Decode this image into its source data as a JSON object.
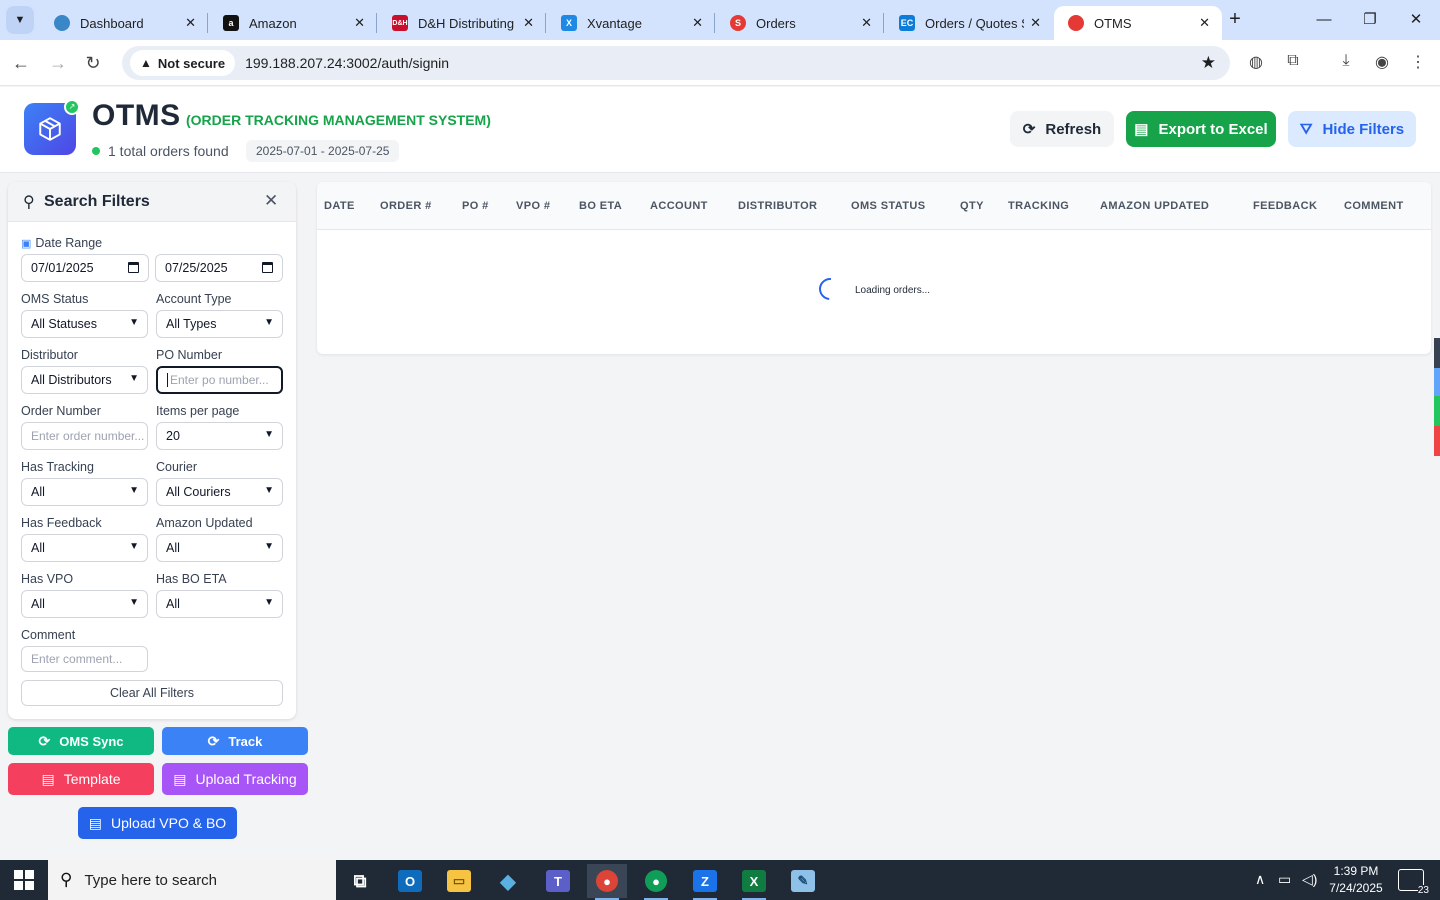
{
  "browser": {
    "tabs": [
      {
        "label": "Dashboard",
        "icon": "dashboard-favicon",
        "color": "#3a87c8"
      },
      {
        "label": "Amazon",
        "icon": "amazon-favicon",
        "color": "#111111"
      },
      {
        "label": "D&H Distributing",
        "icon": "dh-favicon",
        "color": "#c8102e"
      },
      {
        "label": "Xvantage",
        "icon": "xvantage-favicon",
        "color": "#1e88e5"
      },
      {
        "label": "Orders",
        "icon": "orders-favicon",
        "color": "#e53935"
      },
      {
        "label": "Orders / Quotes S",
        "icon": "ec-favicon",
        "color": "#0d7bd8"
      },
      {
        "label": "OTMS",
        "icon": "otms-favicon",
        "color": "#e53935"
      }
    ],
    "security_label": "Not secure",
    "url": "199.188.207.24:3002/auth/signin"
  },
  "header": {
    "title": "OTMS",
    "subtitle": "(ORDER TRACKING MANAGEMENT SYSTEM)",
    "orders_found": "1 total orders found",
    "date_range": "2025-07-01 - 2025-07-25",
    "refresh_label": "Refresh",
    "export_label": "Export to Excel",
    "hide_filters_label": "Hide Filters"
  },
  "filters": {
    "title": "Search Filters",
    "date_range_label": "Date Range",
    "date_from": "07/01/2025",
    "date_to": "07/25/2025",
    "oms_status_label": "OMS Status",
    "oms_status_value": "All Statuses",
    "account_type_label": "Account Type",
    "account_type_value": "All Types",
    "distributor_label": "Distributor",
    "distributor_value": "All Distributors",
    "po_number_label": "PO Number",
    "po_number_placeholder": "Enter po number...",
    "order_number_label": "Order Number",
    "order_number_placeholder": "Enter order number...",
    "items_per_page_label": "Items per page",
    "items_per_page_value": "20",
    "has_tracking_label": "Has Tracking",
    "has_tracking_value": "All",
    "courier_label": "Courier",
    "courier_value": "All Couriers",
    "has_feedback_label": "Has Feedback",
    "has_feedback_value": "All",
    "amazon_updated_label": "Amazon Updated",
    "amazon_updated_value": "All",
    "has_vpo_label": "Has VPO",
    "has_vpo_value": "All",
    "has_bo_eta_label": "Has BO ETA",
    "has_bo_eta_value": "All",
    "comment_label": "Comment",
    "comment_placeholder": "Enter comment...",
    "clear_label": "Clear All Filters"
  },
  "actions": {
    "oms_sync": "OMS Sync",
    "track": "Track",
    "template": "Template",
    "upload_tracking": "Upload Tracking",
    "upload_vpo_bo": "Upload VPO & BO"
  },
  "table": {
    "columns": [
      "DATE",
      "ORDER #",
      "PO #",
      "VPO #",
      "BO ETA",
      "ACCOUNT",
      "DISTRIBUTOR",
      "OMS STATUS",
      "QTY",
      "TRACKING",
      "AMAZON UPDATED",
      "FEEDBACK",
      "COMMENT"
    ],
    "loading_text": "Loading orders..."
  },
  "taskbar": {
    "search_placeholder": "Type here to search",
    "time": "1:39 PM",
    "date": "7/24/2025",
    "notification_count": "23"
  },
  "colors": {
    "primary_green": "#16a34a",
    "primary_blue": "#3b82f6",
    "light_blue": "#dbeafe",
    "pink_red": "#f43f5e",
    "purple": "#a855f7",
    "teal_green": "#10b981"
  }
}
